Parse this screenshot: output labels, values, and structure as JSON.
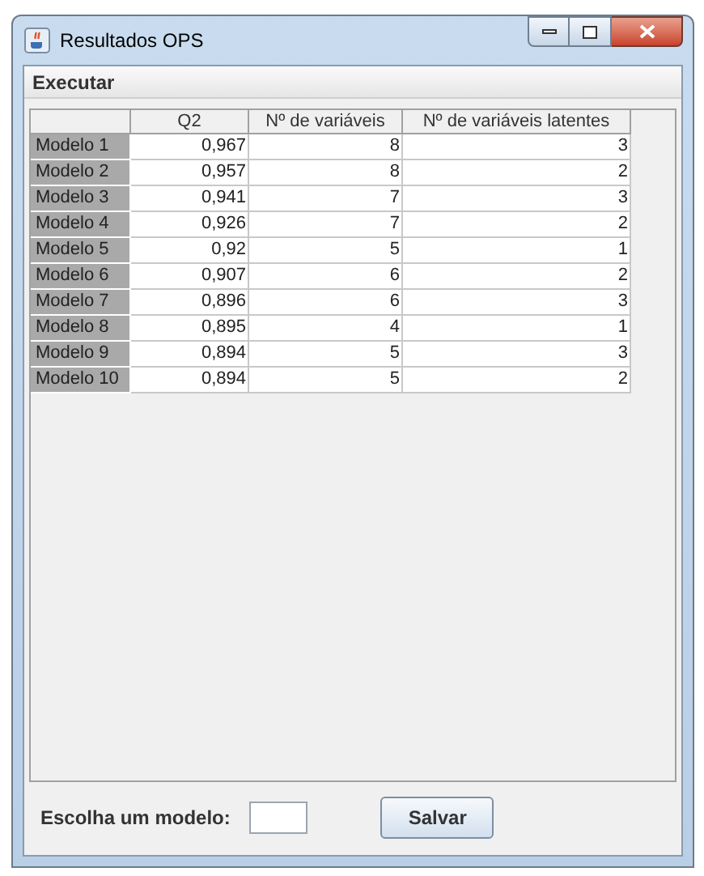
{
  "window": {
    "title": "Resultados OPS"
  },
  "menu": [
    "Executar"
  ],
  "table": {
    "columns": [
      "Q2",
      "Nº de variáveis",
      "Nº de variáveis latentes"
    ],
    "rows": [
      {
        "header": "Modelo 1",
        "cells": [
          "0,967",
          "8",
          "3"
        ]
      },
      {
        "header": "Modelo 2",
        "cells": [
          "0,957",
          "8",
          "2"
        ]
      },
      {
        "header": "Modelo 3",
        "cells": [
          "0,941",
          "7",
          "3"
        ]
      },
      {
        "header": "Modelo 4",
        "cells": [
          "0,926",
          "7",
          "2"
        ]
      },
      {
        "header": "Modelo 5",
        "cells": [
          "0,92",
          "5",
          "1"
        ]
      },
      {
        "header": "Modelo 6",
        "cells": [
          "0,907",
          "6",
          "2"
        ]
      },
      {
        "header": "Modelo 7",
        "cells": [
          "0,896",
          "6",
          "3"
        ]
      },
      {
        "header": "Modelo 8",
        "cells": [
          "0,895",
          "4",
          "1"
        ]
      },
      {
        "header": "Modelo 9",
        "cells": [
          "0,894",
          "5",
          "3"
        ]
      },
      {
        "header": "Modelo 10",
        "cells": [
          "0,894",
          "5",
          "2"
        ]
      }
    ]
  },
  "footer": {
    "label": "Escolha um modelo:",
    "button": "Salvar"
  }
}
